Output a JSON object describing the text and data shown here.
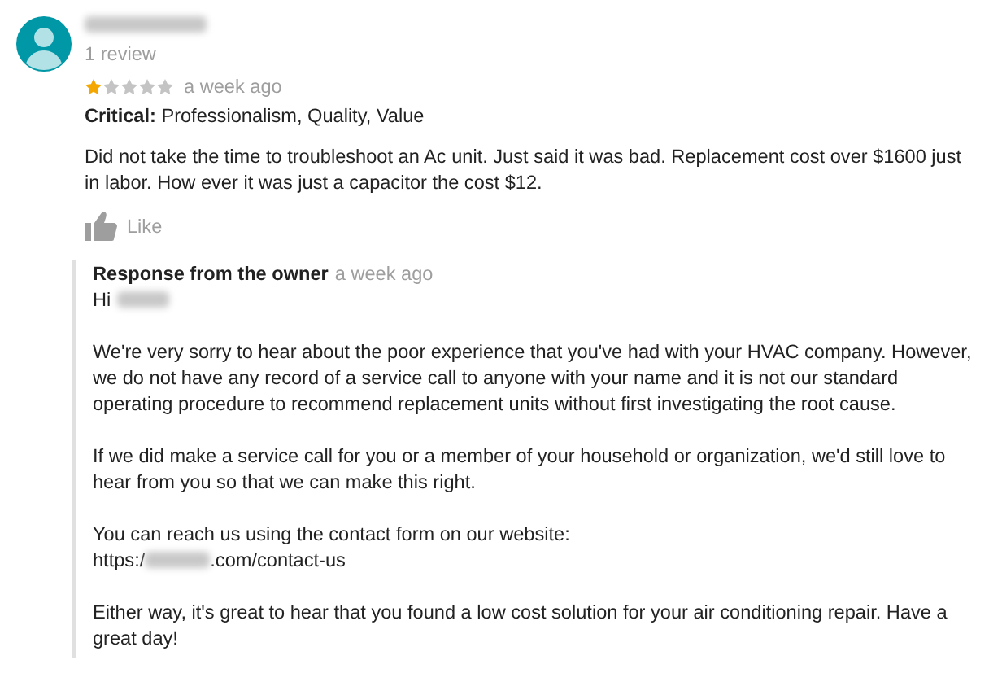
{
  "review": {
    "review_count": "1 review",
    "stars": 1,
    "time": "a week ago",
    "critical_label": "Critical:",
    "critical_items": "Professionalism, Quality, Value",
    "text": "Did not take the time to troubleshoot an Ac unit. Just said it was bad. Replacement cost over $1600 just in labor.  How ever it was just a capacitor the cost $12.",
    "like": "Like"
  },
  "response": {
    "title": "Response from the owner",
    "time": "a week ago",
    "greeting": "Hi",
    "paragraphs": [
      "We're very sorry to hear about the poor experience that you've had with your HVAC company. However, we do not have any record of a service call to anyone with your name and it is not our standard operating procedure to recommend replacement units without first investigating the root cause.",
      "If we did make a service call for you or a member of your household or organization, we'd still love to hear from you so that we can make this right."
    ],
    "contact_text": "You can reach us using the contact form on our website:",
    "url_prefix": "https:/",
    "url_suffix": ".com/contact-us",
    "closing": "Either way, it's great to hear that you found a low cost solution for your air conditioning repair. Have a great day!"
  }
}
